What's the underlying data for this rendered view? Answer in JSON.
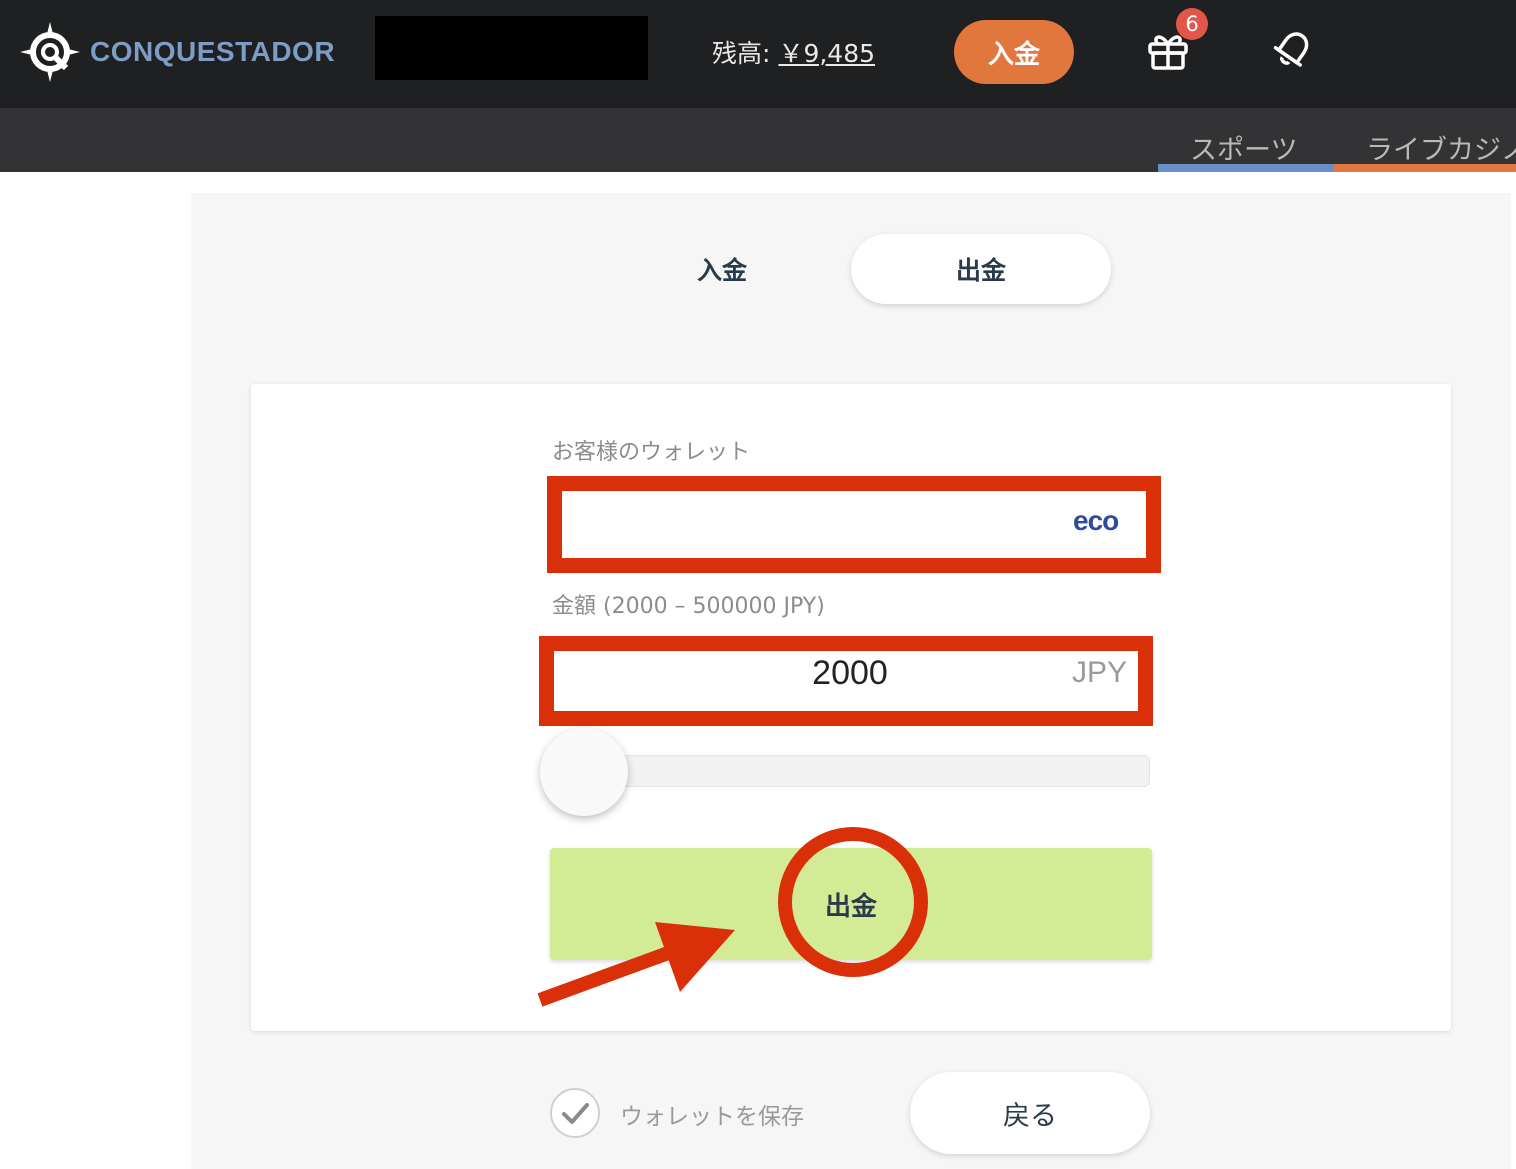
{
  "header": {
    "logo_text": "CONQUESTADOR",
    "balance_label": "残高:",
    "balance_amount": "￥9,485",
    "deposit_label": "入金",
    "gift_badge_count": "6",
    "icons": [
      "logo-compass-icon",
      "gift-icon",
      "bell-icon"
    ]
  },
  "subnav": {
    "items": [
      {
        "label": "スポーツ",
        "accent": "#6a8fc4"
      },
      {
        "label": "ライブカジノ",
        "accent": "#e2773d"
      }
    ]
  },
  "tabs": [
    {
      "label": "入金",
      "active": false
    },
    {
      "label": "出金",
      "active": true
    }
  ],
  "form": {
    "wallet_label": "お客様のウォレット",
    "wallet_value": "",
    "wallet_brand": "eco",
    "amount_label": "金額 (2000 – 500000 JPY)",
    "amount_value": "2000",
    "amount_currency": "JPY",
    "slider_fraction": 0,
    "submit_label": "出金"
  },
  "footer": {
    "save_wallet_label": "ウォレットを保存",
    "save_wallet_checked": true,
    "back_label": "戻る"
  },
  "colors": {
    "header_bg": "#1f2022",
    "accent_orange": "#e2773d",
    "highlight_red": "#d9300a",
    "submit_green": "#d4eb95"
  }
}
